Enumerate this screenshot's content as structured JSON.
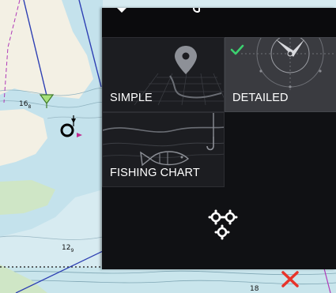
{
  "chart": {
    "depth_soundings": [
      {
        "name": "sounding-16-8",
        "main": "16",
        "sub": "8"
      },
      {
        "name": "sounding-12-9",
        "main": "12",
        "sub": "9"
      },
      {
        "name": "sounding-18",
        "main": "18",
        "sub": ""
      }
    ]
  },
  "menu": {
    "options": [
      {
        "name": "simple",
        "label": "SIMPLE",
        "selected": false,
        "icon": "map-pin-icon"
      },
      {
        "name": "detailed",
        "label": "DETAILED",
        "selected": true,
        "icon": "compass-rose-icon"
      },
      {
        "name": "fishing",
        "label": "FISHING CHART",
        "selected": false,
        "icon": "fish-hook-icon"
      }
    ],
    "selected_check_color": "#3bd16f",
    "settings_icon": "gears-icon"
  },
  "colors": {
    "land": "#f2efe6",
    "shallow_water": "#b8dbe6",
    "deep_water": "#dcedf2",
    "route": "#2d3fb3",
    "marker_red": "#e8342a"
  }
}
